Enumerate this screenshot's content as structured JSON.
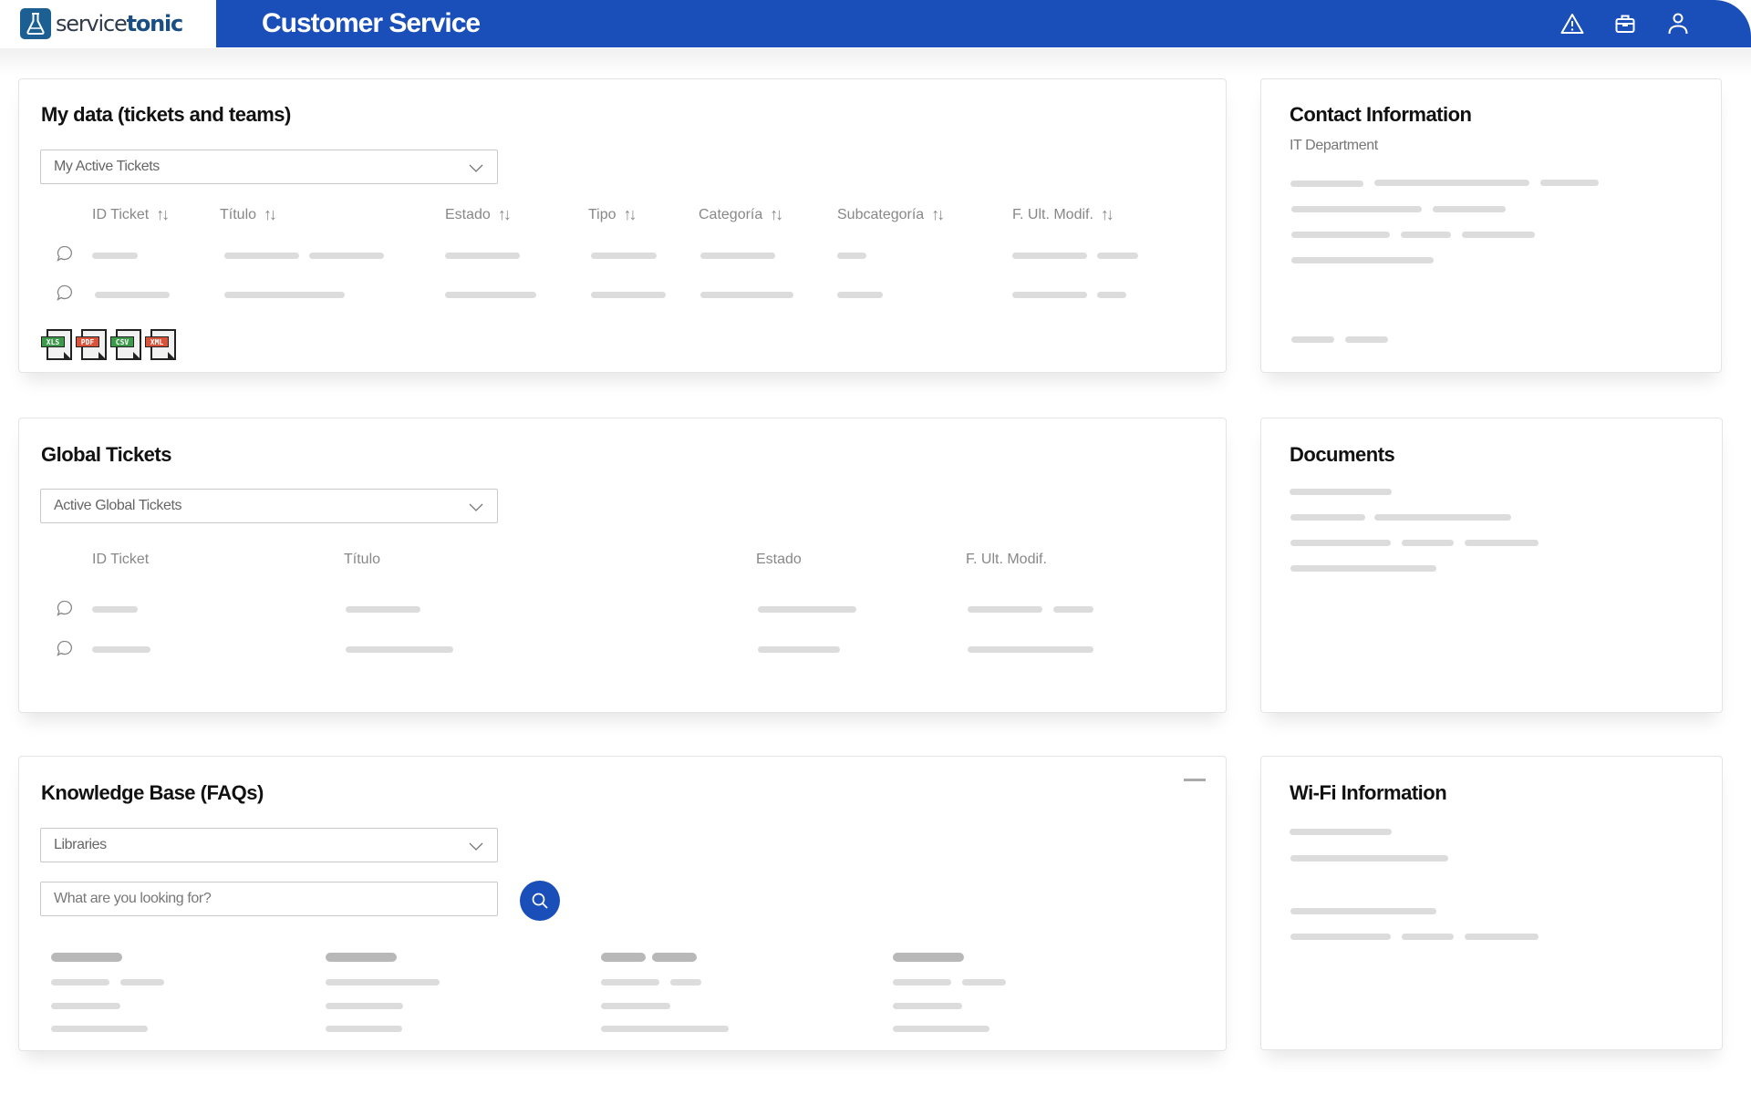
{
  "header": {
    "logo_text_light": "service",
    "logo_text_bold": "tonic",
    "app_title": "Customer Service",
    "icons": [
      "warning-icon",
      "briefcase-icon",
      "user-icon"
    ],
    "brand_color": "#1a4fba"
  },
  "my_data": {
    "title": "My data (tickets and teams)",
    "select_value": "My Active Tickets",
    "columns": [
      "ID Ticket",
      "Título",
      "Estado",
      "Tipo",
      "Categoría",
      "Subcategoría",
      "F. Ult. Modif."
    ],
    "row_count": 2,
    "exports": [
      "XLS",
      "PDF",
      "CSV",
      "XML"
    ],
    "export_colors": {
      "XLS": "#3d9a4a",
      "PDF": "#d9533b",
      "CSV": "#3d9a4a",
      "XML": "#d9533b"
    }
  },
  "global_tickets": {
    "title": "Global Tickets",
    "select_value": "Active Global Tickets",
    "columns": [
      "ID Ticket",
      "Título",
      "Estado",
      "F. Ult. Modif."
    ],
    "row_count": 2
  },
  "knowledge_base": {
    "title": "Knowledge Base (FAQs)",
    "select_value": "Libraries",
    "search_placeholder": "What are you looking for?"
  },
  "contact_info": {
    "title": "Contact Information",
    "subtitle": "IT Department"
  },
  "documents": {
    "title": "Documents"
  },
  "wifi": {
    "title": "Wi-Fi Information"
  }
}
